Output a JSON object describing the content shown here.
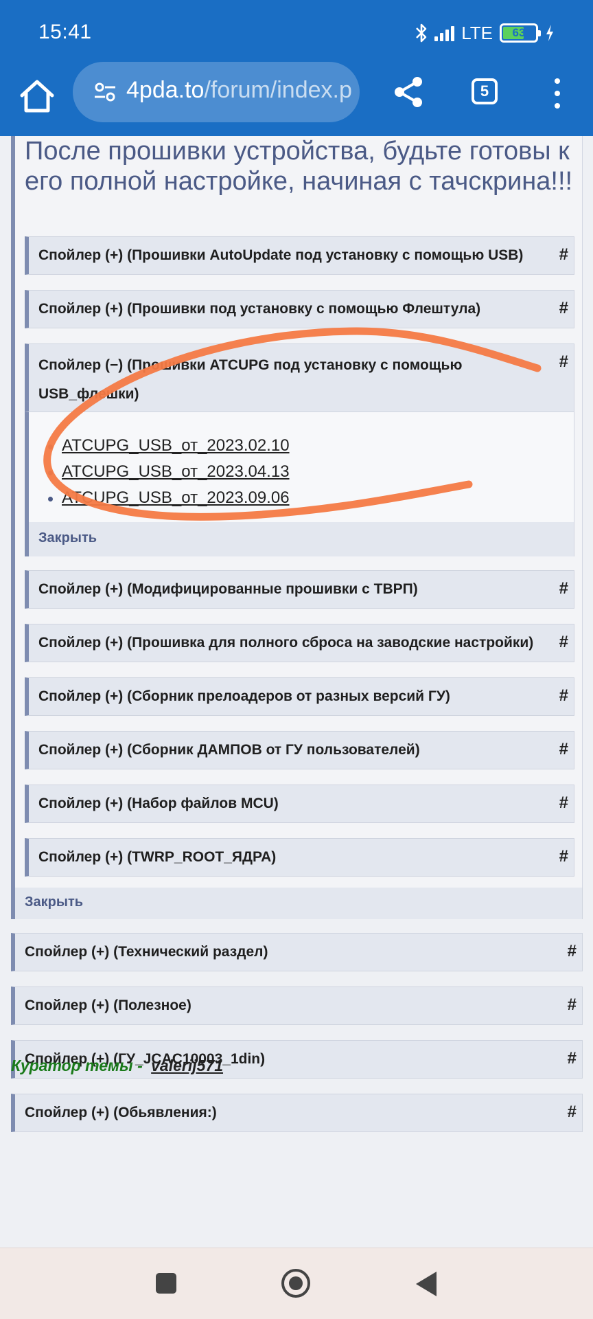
{
  "status_bar": {
    "time": "15:41",
    "network": "LTE",
    "battery": "63"
  },
  "browser": {
    "url_host": "4pda.to",
    "url_path": "/forum/index.p",
    "tab_count": "5"
  },
  "page": {
    "heading": "После прошивки устройства, будьте готовы к его полной настройке, начиная с тачскрина!!!",
    "inner_spoilers": [
      "Спойлер (+) (Прошивки AutoUpdate под установку с помощью USB)",
      "Спойлер (+) (Прошивки под установку с помощью Флештула)"
    ],
    "open_spoiler": {
      "label": "Спойлер (−) (Прошивки ATCUPG под установку с помощью USB_флешки)",
      "links": [
        "ATCUPG_USB_от_2023.02.10",
        "ATCUPG_USB_от_2023.04.13",
        "ATCUPG_USB_от_2023.09.06"
      ],
      "close_label": "Закрыть"
    },
    "inner_spoilers_after": [
      "Спойлер (+) (Модифицированные прошивки с ТВРП)",
      "Спойлер (+) (Прошивка для полного сброса на заводские настройки)",
      "Спойлер (+) (Сборник прелоадеров от разных версий ГУ)",
      "Спойлер (+) (Сборник ДАМПОВ от ГУ пользователей)",
      "Спойлер (+) (Набор файлов MCU)",
      "Спойлер (+) (TWRP_ROOT_ЯДРА)"
    ],
    "outer_close_label": "Закрыть",
    "outer_spoilers": [
      "Спойлер (+) (Технический раздел)",
      "Спойлер (+) (Полезное)",
      "Спойлер (+) (ГУ_JCAC10003_1din)",
      "Спойлер (+) (Обьявления:)"
    ],
    "anchor_symbol": "#",
    "curator_label": "Куратор темы - ",
    "curator_name": "valerij571"
  },
  "colors": {
    "browser_bar": "#1a6ec4",
    "annotation": "#f47a45",
    "curator": "#1a7a1a"
  }
}
